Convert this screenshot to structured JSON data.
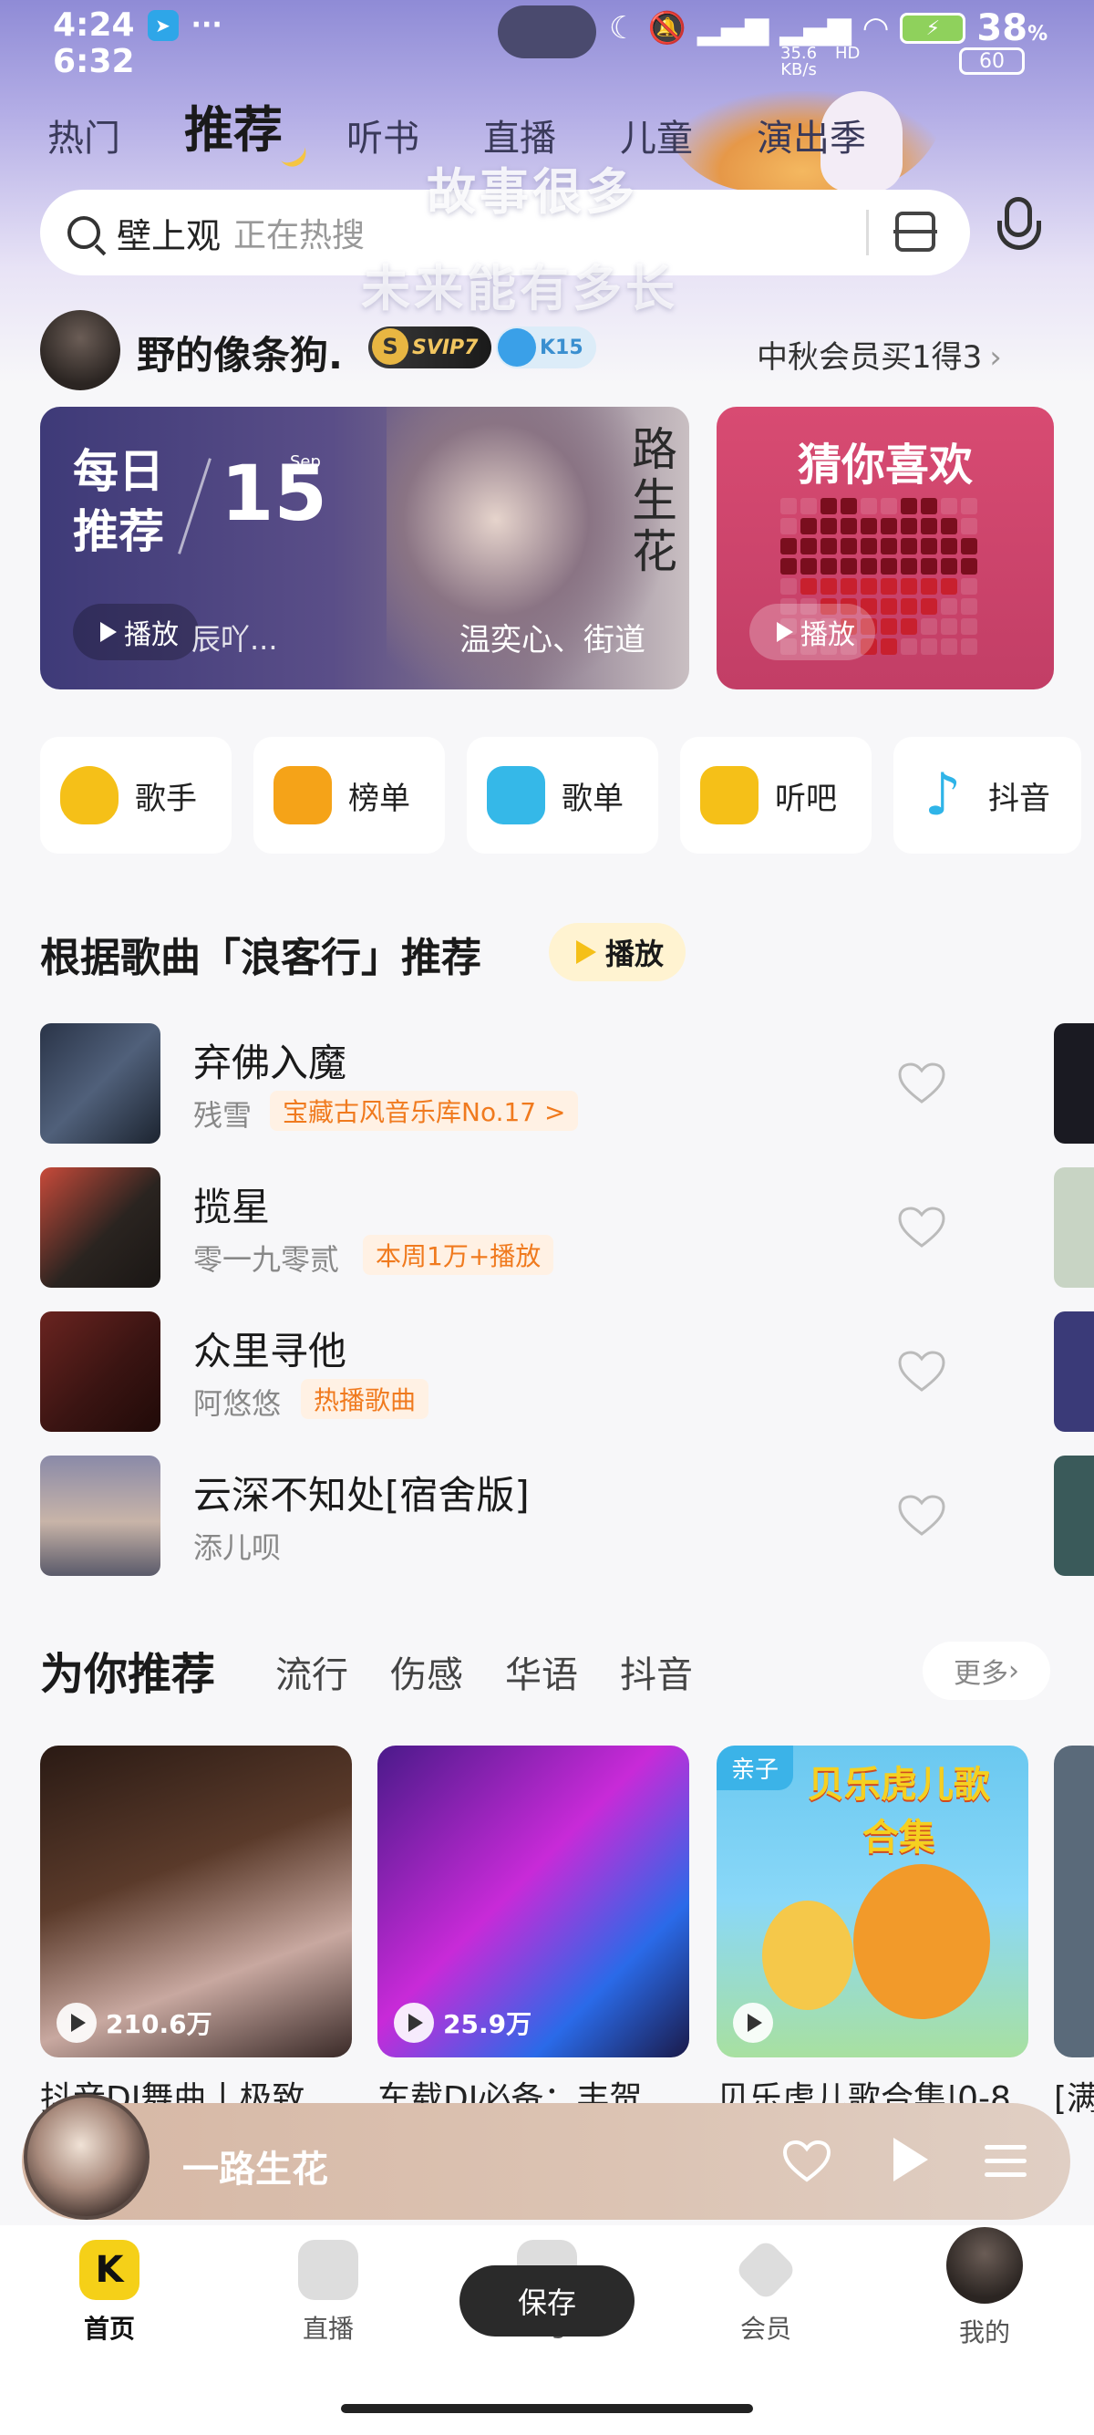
{
  "status_bar": {
    "time_top": "4:24",
    "time_bottom": "6:32",
    "more_dots": "···",
    "battery_pct": "38",
    "battery_unit": "%",
    "net_speed_value": "35.6",
    "net_speed_unit": "KB/s",
    "hd": "HD",
    "battery2": "60"
  },
  "top_tabs": [
    {
      "label": "热门"
    },
    {
      "label": "推荐",
      "active": true
    },
    {
      "label": "听书"
    },
    {
      "label": "直播"
    },
    {
      "label": "儿童"
    },
    {
      "label": "演出季"
    }
  ],
  "overlay_lyrics": {
    "line1": "故事很多",
    "line2": "未来能有多长"
  },
  "search": {
    "keyword": "壁上观",
    "hint": "正在热搜"
  },
  "user": {
    "name": "野的像条狗.",
    "svip_badge": "SVIP7",
    "level_badge": "K15",
    "promo": "中秋会员买1得3"
  },
  "daily_card": {
    "title": "每日推荐",
    "day": "15",
    "month": "Sep",
    "vertical_text": "路生花",
    "play_label": "播放",
    "sub_text": "辰吖...",
    "tail_text": "温奕心、街道"
  },
  "guess_card": {
    "title": "猜你喜欢",
    "play_label": "播放"
  },
  "quick_entries": [
    {
      "label": "歌手",
      "icon": "singer-icon",
      "color": "#f5c018"
    },
    {
      "label": "榜单",
      "icon": "chart-icon",
      "color": "#f5a318"
    },
    {
      "label": "歌单",
      "icon": "playlist-icon",
      "color": "#35b8e8"
    },
    {
      "label": "听吧",
      "icon": "radio-icon",
      "color": "#f5c018"
    },
    {
      "label": "抖音",
      "icon": "douyin-icon",
      "color": "#2fb4e8"
    }
  ],
  "song_section": {
    "title": "根据歌曲「浪客行」推荐",
    "play_label": "播放",
    "songs": [
      {
        "title": "弃佛入魔",
        "artist": "残雪",
        "tag": "宝藏古风音乐库No.17 >"
      },
      {
        "title": "揽星",
        "artist": "零一九零贰",
        "tag": "本周1万+播放"
      },
      {
        "title": "众里寻他",
        "artist": "阿悠悠",
        "tag": "热播歌曲"
      },
      {
        "title": "云深不知处[宿舍版]",
        "artist": "添儿呗",
        "tag": ""
      }
    ]
  },
  "for_you": {
    "title": "为你推荐",
    "tabs": [
      "流行",
      "伤感",
      "华语",
      "抖音"
    ],
    "more": "更多",
    "playlists": [
      {
        "count": "210.6万",
        "name": "抖音DJ舞曲丨极致"
      },
      {
        "count": "25.9万",
        "name": "车载DJ必备：丰贺"
      },
      {
        "count": "",
        "name": "贝乐虎儿歌合集|0-8",
        "badge": "亲子",
        "cover_text": "贝乐虎儿歌合集"
      }
    ],
    "partial_name": "[满"
  },
  "mini_player": {
    "title": "一路生花"
  },
  "bottom_nav": [
    {
      "label": "首页",
      "active": true
    },
    {
      "label": "直播"
    },
    {
      "label": "ing"
    },
    {
      "label": "会员"
    },
    {
      "label": "我的"
    }
  ],
  "toast": "保存",
  "colors": {
    "accent": "#f5c018",
    "tag_orange": "#f07a1e"
  }
}
